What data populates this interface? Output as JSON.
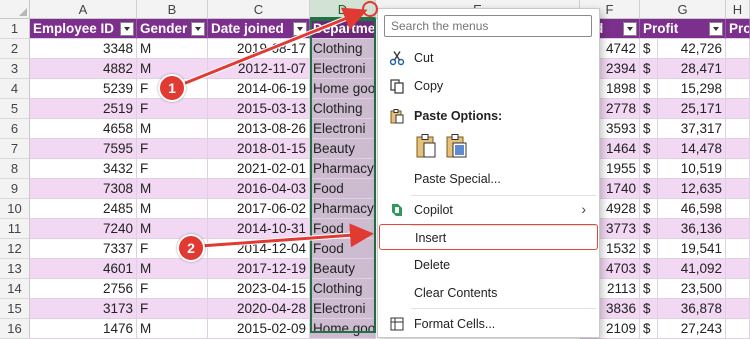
{
  "columns": [
    "A",
    "B",
    "C",
    "D",
    "E",
    "F",
    "G",
    "H"
  ],
  "header_row": {
    "employee_id": "Employee ID",
    "gender": "Gender",
    "date_joined": "Date joined",
    "department": "Departme",
    "sold": "old",
    "profit": "Profit",
    "extra": "Pro"
  },
  "rows": [
    {
      "n": "2",
      "id": "3348",
      "g": "M",
      "date": "2019-08-17",
      "dept": "Clothing",
      "sold": "4742",
      "cur": "$",
      "profit": "42,726"
    },
    {
      "n": "3",
      "id": "4882",
      "g": "M",
      "date": "2012-11-07",
      "dept": "Electroni",
      "sold": "2394",
      "cur": "$",
      "profit": "28,471"
    },
    {
      "n": "4",
      "id": "5239",
      "g": "F",
      "date": "2014-06-19",
      "dept": "Home goo",
      "sold": "1898",
      "cur": "$",
      "profit": "15,298"
    },
    {
      "n": "5",
      "id": "2519",
      "g": "F",
      "date": "2015-03-13",
      "dept": "Clothing",
      "sold": "2778",
      "cur": "$",
      "profit": "25,171"
    },
    {
      "n": "6",
      "id": "4658",
      "g": "M",
      "date": "2013-08-26",
      "dept": "Electroni",
      "sold": "3593",
      "cur": "$",
      "profit": "37,317"
    },
    {
      "n": "7",
      "id": "7595",
      "g": "F",
      "date": "2018-01-15",
      "dept": "Beauty",
      "sold": "1464",
      "cur": "$",
      "profit": "14,478"
    },
    {
      "n": "8",
      "id": "3432",
      "g": "F",
      "date": "2021-02-01",
      "dept": "Pharmacy",
      "sold": "1955",
      "cur": "$",
      "profit": "10,519"
    },
    {
      "n": "9",
      "id": "7308",
      "g": "M",
      "date": "2016-04-03",
      "dept": "Food",
      "sold": "1740",
      "cur": "$",
      "profit": "12,635"
    },
    {
      "n": "10",
      "id": "2485",
      "g": "M",
      "date": "2017-06-02",
      "dept": "Pharmacy",
      "sold": "4928",
      "cur": "$",
      "profit": "46,598"
    },
    {
      "n": "11",
      "id": "7240",
      "g": "M",
      "date": "2014-10-31",
      "dept": "Food",
      "sold": "3773",
      "cur": "$",
      "profit": "36,136"
    },
    {
      "n": "12",
      "id": "7337",
      "g": "F",
      "date": "2014-12-04",
      "dept": "Food",
      "sold": "1532",
      "cur": "$",
      "profit": "19,541"
    },
    {
      "n": "13",
      "id": "4601",
      "g": "M",
      "date": "2017-12-19",
      "dept": "Beauty",
      "sold": "4703",
      "cur": "$",
      "profit": "41,092"
    },
    {
      "n": "14",
      "id": "2756",
      "g": "F",
      "date": "2023-04-15",
      "dept": "Clothing",
      "sold": "2113",
      "cur": "$",
      "profit": "23,500"
    },
    {
      "n": "15",
      "id": "3173",
      "g": "F",
      "date": "2020-04-28",
      "dept": "Electroni",
      "sold": "3836",
      "cur": "$",
      "profit": "36,878"
    },
    {
      "n": "16",
      "id": "1476",
      "g": "M",
      "date": "2015-02-09",
      "dept": "Home goo",
      "sold": "2109",
      "cur": "$",
      "profit": "27,243"
    }
  ],
  "header_row_number": "1",
  "context_menu": {
    "search_placeholder": "Search the menus",
    "items": {
      "cut": "Cut",
      "copy": "Copy",
      "paste_options": "Paste Options:",
      "paste_special": "Paste Special...",
      "copilot": "Copilot",
      "insert": "Insert",
      "delete": "Delete",
      "clear_contents": "Clear Contents",
      "format_cells": "Format Cells..."
    }
  },
  "callouts": {
    "one": "1",
    "two": "2"
  },
  "colors": {
    "header_purple": "#7c2f8c",
    "row_pink": "#f2d8f3",
    "excel_green": "#217346",
    "callout_red": "#e03a33"
  }
}
